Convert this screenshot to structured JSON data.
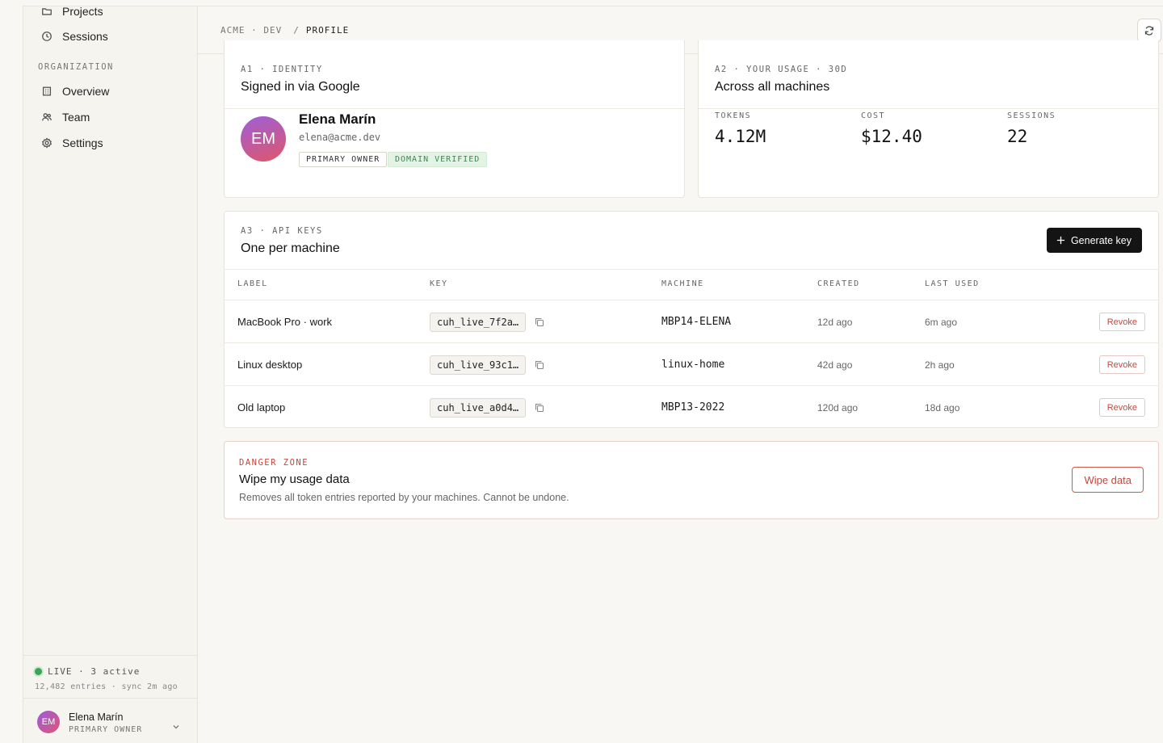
{
  "sidebar": {
    "top_items": [
      {
        "label": "Projects",
        "icon": "folder-icon"
      },
      {
        "label": "Sessions",
        "icon": "clock-icon"
      }
    ],
    "org_section_label": "ORGANIZATION",
    "org_items": [
      {
        "label": "Overview",
        "icon": "building-icon"
      },
      {
        "label": "Team",
        "icon": "users-icon"
      },
      {
        "label": "Settings",
        "icon": "gear-icon"
      }
    ],
    "live": {
      "status": "LIVE · 3 active",
      "sub": "12,482 entries · sync 2m ago"
    },
    "user": {
      "initials": "EM",
      "name": "Elena Marín",
      "role": "PRIMARY OWNER"
    }
  },
  "topbar": {
    "crumbs": [
      "ACME · DEV",
      "/",
      "PROFILE"
    ]
  },
  "identity": {
    "label": "A1 · IDENTITY",
    "title": "Signed in via Google",
    "initials": "EM",
    "name": "Elena Marín",
    "email": "elena@acme.dev",
    "badge_owner": "PRIMARY OWNER",
    "badge_verified": "DOMAIN VERIFIED"
  },
  "usage": {
    "label": "A2 · YOUR USAGE · 30D",
    "title": "Across all machines",
    "stats": [
      {
        "label": "TOKENS",
        "value": "4.12M"
      },
      {
        "label": "COST",
        "value": "$12.40"
      },
      {
        "label": "SESSIONS",
        "value": "22"
      }
    ]
  },
  "api_keys": {
    "label": "A3 · API KEYS",
    "title": "One per machine",
    "generate_label": "Generate key",
    "columns": [
      "LABEL",
      "KEY",
      "MACHINE",
      "CREATED",
      "LAST USED"
    ],
    "revoke_label": "Revoke",
    "rows": [
      {
        "label": "MacBook Pro · work",
        "key": "cuh_live_7f2a…",
        "machine": "MBP14-ELENA",
        "created": "12d ago",
        "last_used": "6m ago"
      },
      {
        "label": "Linux desktop",
        "key": "cuh_live_93c1…",
        "machine": "linux-home",
        "created": "42d ago",
        "last_used": "2h ago"
      },
      {
        "label": "Old laptop",
        "key": "cuh_live_a0d4…",
        "machine": "MBP13-2022",
        "created": "120d ago",
        "last_used": "18d ago"
      }
    ]
  },
  "danger": {
    "label": "DANGER ZONE",
    "title": "Wipe my usage data",
    "description": "Removes all token entries reported by your machines. Cannot be undone.",
    "button": "Wipe data"
  },
  "colors": {
    "accent": "#141414",
    "danger": "#c4473c",
    "success": "#3aa55a"
  }
}
